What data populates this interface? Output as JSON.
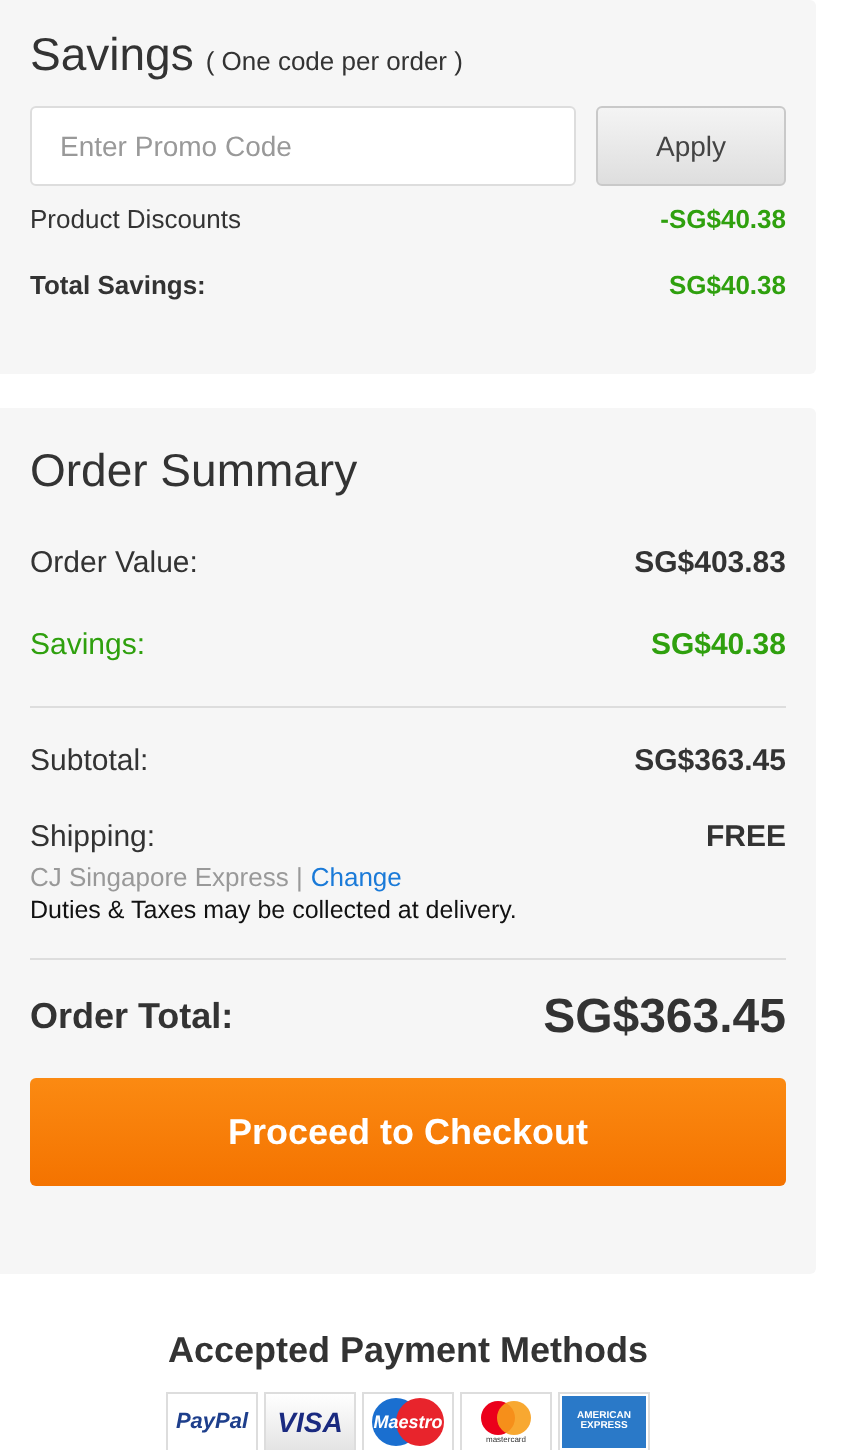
{
  "savings": {
    "title": "Savings",
    "note": "( One code per order )",
    "promo": {
      "placeholder": "Enter Promo Code"
    },
    "apply_button": "Apply",
    "rows": [
      {
        "label": "Product Discounts",
        "value": "-SG$40.38",
        "bold": false
      },
      {
        "label": "Total Savings:",
        "value": "SG$40.38",
        "bold": true
      }
    ]
  },
  "order_summary": {
    "title": "Order Summary",
    "rows": [
      {
        "label": "Order Value:",
        "value": "SG$403.83",
        "kind": "normal"
      },
      {
        "label": "Savings:",
        "value": "SG$40.38",
        "kind": "savings"
      }
    ],
    "subtotal": {
      "label": "Subtotal:",
      "value": "SG$363.45"
    },
    "shipping": {
      "label": "Shipping:",
      "value": "FREE",
      "carrier": "CJ Singapore Express |",
      "change_link": "Change",
      "note": "Duties & Taxes may be collected at delivery."
    },
    "total": {
      "label": "Order Total:",
      "value": "SG$363.45"
    },
    "checkout_button": "Proceed to Checkout"
  },
  "payment": {
    "title": "Accepted Payment Methods",
    "methods": [
      {
        "kind": "paypal",
        "text": "PayPal"
      },
      {
        "kind": "visa",
        "text": "VISA"
      },
      {
        "kind": "maestro",
        "text": "Maestro"
      },
      {
        "kind": "mastercard",
        "text": "mastercard"
      },
      {
        "kind": "amex",
        "text": "AMERICAN EXPRESS"
      }
    ]
  }
}
